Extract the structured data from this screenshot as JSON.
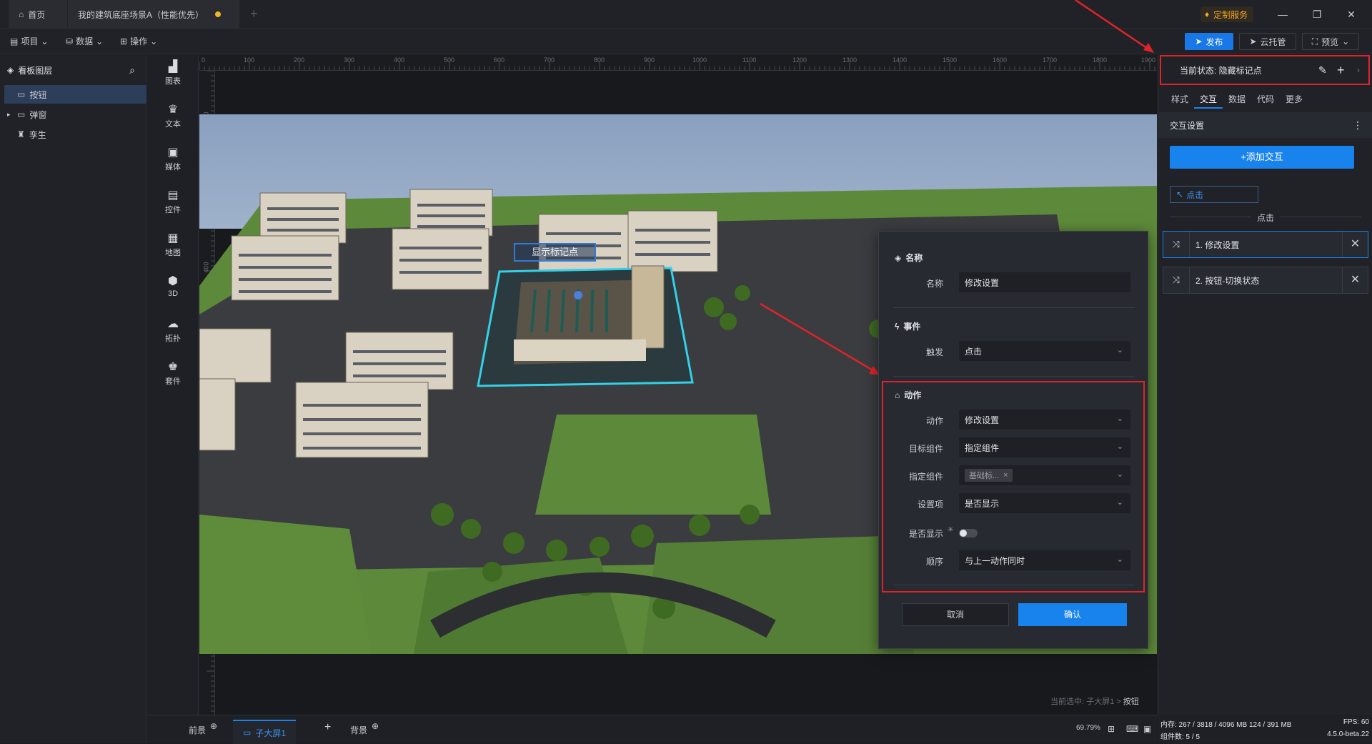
{
  "titlebar": {
    "home_tab": "首页",
    "doc_tab": "我的建筑底座场景A（性能优先）",
    "custom_service": "定制服务"
  },
  "menubar": {
    "project": "项目",
    "data": "数据",
    "operate": "操作",
    "publish": "发布",
    "cloud": "云托管",
    "preview": "预览"
  },
  "layers": {
    "title": "看板图层",
    "items": [
      {
        "label": "按钮",
        "selected": true
      },
      {
        "label": "弹窗",
        "selected": false
      },
      {
        "label": "孪生",
        "selected": false
      }
    ]
  },
  "tools": [
    "图表",
    "文本",
    "媒体",
    "控件",
    "地图",
    "3D",
    "拓扑",
    "套件"
  ],
  "ruler_h": [
    "0",
    "100",
    "200",
    "300",
    "400",
    "500",
    "600",
    "700",
    "800",
    "900",
    "1000",
    "1100",
    "1200",
    "1300",
    "1400",
    "1500",
    "1600",
    "1700",
    "1800",
    "1900"
  ],
  "ruler_v": [
    "100",
    "200",
    "300",
    "400",
    "500",
    "600",
    "700",
    "800",
    "900",
    "1000",
    "1100"
  ],
  "canvas": {
    "marker_label": "显示标记点",
    "crumb_prefix": "当前选中: 子大屏1 > ",
    "crumb_current": "按钮"
  },
  "bottom": {
    "tab_front": "前景",
    "tab_screen": "子大屏1",
    "tab_bg": "背景",
    "zoom": "69.79%"
  },
  "dialog": {
    "sec_name": "名称",
    "name_label": "名称",
    "name_value": "修改设置",
    "sec_event": "事件",
    "trigger_label": "触发",
    "trigger_value": "点击",
    "sec_action": "动作",
    "action_label": "动作",
    "action_value": "修改设置",
    "target_label": "目标组件",
    "target_value": "指定组件",
    "specify_label": "指定组件",
    "specify_tag": "基础标...",
    "setting_label": "设置项",
    "setting_value": "是否显示",
    "show_label": "是否显示",
    "order_label": "顺序",
    "order_value": "与上一动作同时",
    "cancel": "取消",
    "confirm": "确认"
  },
  "right": {
    "state": "当前状态:  隐藏标记点",
    "tabs": [
      "样式",
      "交互",
      "数据",
      "代码",
      "更多"
    ],
    "active_tab": 1,
    "section": "交互设置",
    "add_btn": "+添加交互",
    "trigger": "点击",
    "group_label": "点击",
    "actions": [
      "1. 修改设置",
      "2. 按钮-切换状态"
    ]
  },
  "status": {
    "memory": "内存:  267 / 3818 / 4096 MB  124 / 391 MB",
    "fps": "FPS:  60",
    "components": "组件数: 5 / 5",
    "version": "4.5.0-beta.22"
  },
  "colors": {
    "accent": "#1883ec",
    "highlight": "#e0232a"
  }
}
